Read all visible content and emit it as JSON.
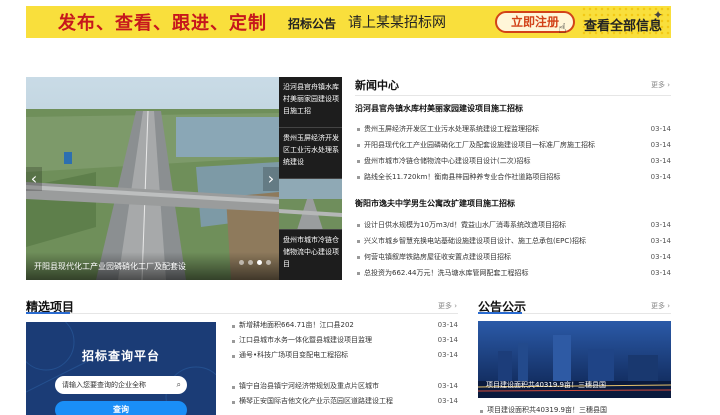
{
  "banner": {
    "slogan": "发布、查看、跟进、定制",
    "sub1": "招标公告",
    "sub2": "请上某某招标网",
    "register_label": "立即注册",
    "view_all_label": "查看全部信息"
  },
  "slider": {
    "caption": "开阳县现代化工产业园磷硝化工厂及配套设",
    "thumbs": [
      {
        "label": "沿河县官舟镇水库村美丽家园建设项目施工招"
      },
      {
        "label": "贵州玉屏经济开发区工业污水处理系统建设"
      },
      {
        "label": ""
      },
      {
        "label": "盘州市城市冷链仓储物流中心建设项目"
      }
    ]
  },
  "news": {
    "title": "新闻中心",
    "more": "更多",
    "groups": [
      {
        "headline": "沿河县官舟镇水库村美丽家园建设项目施工招标",
        "items": [
          {
            "text": "贵州玉屏经济开发区工业污水处理系统建设工程监理招标",
            "date": "03-14"
          },
          {
            "text": "开阳县现代化工产业园磷硝化工厂及配套设施建设项目一标准厂房施工招标",
            "date": "03-14"
          },
          {
            "text": "盘州市城市冷链仓储物流中心建设项目设计(二次)招标",
            "date": "03-14"
          },
          {
            "text": "路线全长11.720km！衡南县梓园种养专业合作社道路项目招标",
            "date": "03-14"
          }
        ]
      },
      {
        "headline": "衡阳市逸夫中学男生公寓改扩建项目施工招标",
        "items": [
          {
            "text": "设计日供水规模为10万m3/d！霓益山水厂消毒系统改造项目招标",
            "date": "03-14"
          },
          {
            "text": "兴义市城乡智慧充换电站基础设施建设项目设计、施工总承包(EPC)招标",
            "date": "03-14"
          },
          {
            "text": "何营屯镇叙岸铁路房屋征收安置点建设项目招标",
            "date": "03-14"
          },
          {
            "text": "总投资为662.44万元！洗马塘水库管网配套工程招标",
            "date": "03-14"
          }
        ]
      }
    ]
  },
  "projects": {
    "title": "精选项目",
    "more": "更多",
    "query_title": "招标查询平台",
    "query_placeholder": "请输入您要查询的企业全称",
    "query_button": "查询",
    "items": [
      {
        "text": "新增耕地面积664.71亩！江口县202",
        "date": "03-14"
      },
      {
        "text": "江口县城市水务一体化暨县城建设项目监理",
        "date": "03-14"
      },
      {
        "text": "通号•科技广场项目变配电工程招标",
        "date": "03-14"
      },
      {
        "text": "",
        "date": ""
      },
      {
        "text": "镇宁自治县镇宁河经济带规划及重点片区城市",
        "date": "03-14"
      },
      {
        "text": "横琴正安国际吉他文化产业示范园区道路建设工程",
        "date": "03-14"
      }
    ]
  },
  "notice": {
    "title": "公告公示",
    "more": "更多",
    "image_caption": "项目建设面积共40319.9亩！三穗县国",
    "items": [
      {
        "text": "项目建设面积共40319.9亩！三穗县国",
        "date": ""
      }
    ]
  },
  "colors": {
    "banner_bg": "#f9df3c",
    "slogan": "#c6171d",
    "accent": "#2a6bd0",
    "query_bg": "#1b3c76",
    "query_button": "#1a8ef7"
  }
}
